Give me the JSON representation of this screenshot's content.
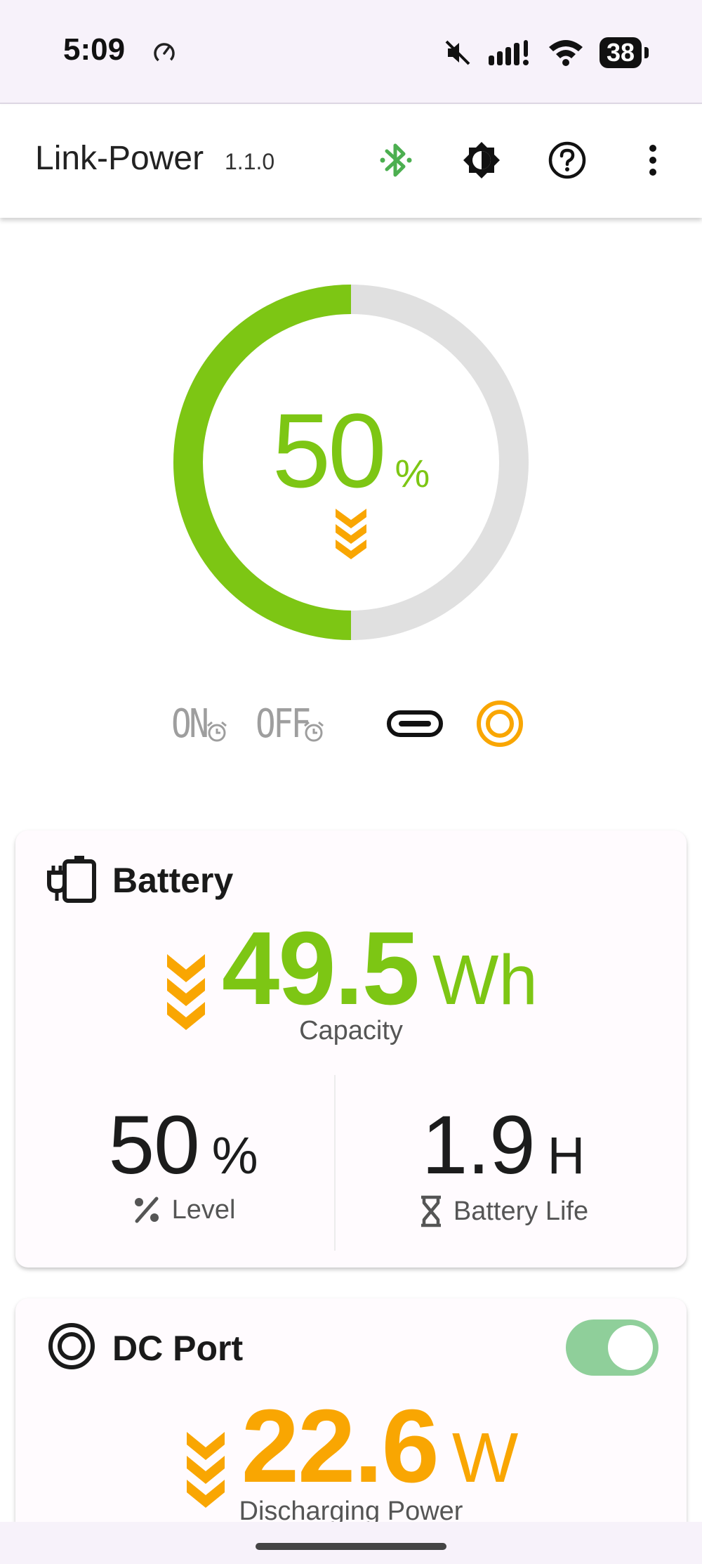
{
  "status_bar": {
    "time": "5:09",
    "battery": "38"
  },
  "app_bar": {
    "title": "Link-Power",
    "version": "1.1.0"
  },
  "gauge": {
    "value": "50",
    "unit": "%",
    "level_fraction": 0.5,
    "fill_color": "#7dc614",
    "track_color": "#e0e0e0"
  },
  "modes": {
    "on_timer": "ON",
    "off_timer": "OFF"
  },
  "battery_card": {
    "title": "Battery",
    "capacity_value": "49.5",
    "capacity_unit": "Wh",
    "capacity_caption": "Capacity",
    "level_value": "50",
    "level_unit": "%",
    "level_label": "Level",
    "life_value": "1.9",
    "life_unit": "H",
    "life_label": "Battery Life"
  },
  "dc_card": {
    "title": "DC Port",
    "toggle_on": true,
    "power_value": "22.6",
    "power_unit": "W",
    "power_caption": "Discharging Power"
  },
  "colors": {
    "green": "#7dc614",
    "orange": "#f9a602",
    "bluetooth_green": "#4caf50"
  }
}
